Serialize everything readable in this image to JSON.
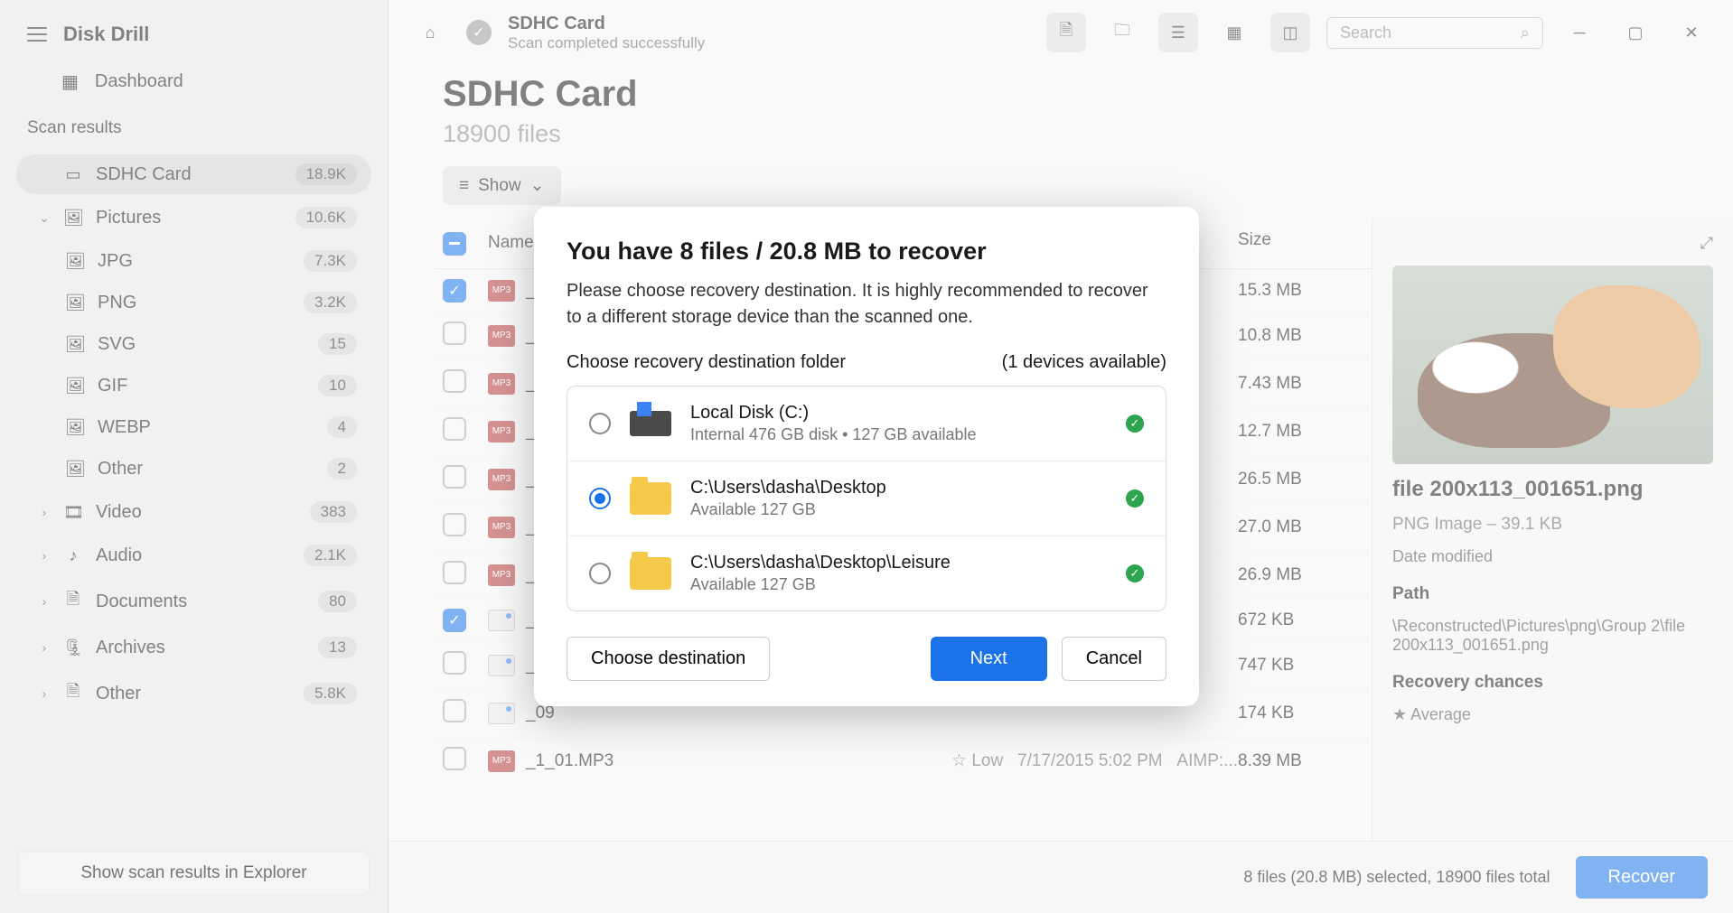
{
  "app": {
    "title": "Disk Drill"
  },
  "sidebar": {
    "dashboard": "Dashboard",
    "scan_results_label": "Scan results",
    "scan_explorer_btn": "Show scan results in Explorer",
    "items": [
      {
        "label": "SDHC Card",
        "count": "18.9K"
      },
      {
        "label": "Pictures",
        "count": "10.6K"
      },
      {
        "label": "JPG",
        "count": "7.3K"
      },
      {
        "label": "PNG",
        "count": "3.2K"
      },
      {
        "label": "SVG",
        "count": "15"
      },
      {
        "label": "GIF",
        "count": "10"
      },
      {
        "label": "WEBP",
        "count": "4"
      },
      {
        "label": "Other",
        "count": "2"
      },
      {
        "label": "Video",
        "count": "383"
      },
      {
        "label": "Audio",
        "count": "2.1K"
      },
      {
        "label": "Documents",
        "count": "80"
      },
      {
        "label": "Archives",
        "count": "13"
      },
      {
        "label": "Other",
        "count": "5.8K"
      }
    ]
  },
  "header": {
    "title": "SDHC Card",
    "status": "Scan completed successfully",
    "search_placeholder": "Search"
  },
  "content": {
    "h1": "SDHC Card",
    "subhead": "18900 files",
    "show_chip": "Show",
    "table_headers": {
      "name": "Name",
      "size": "Size"
    },
    "rows": [
      {
        "name": "_0_",
        "type": "mp3",
        "size": "15.3 MB",
        "checked": true
      },
      {
        "name": "_0_",
        "type": "mp3",
        "size": "10.8 MB",
        "checked": false
      },
      {
        "name": "_0_",
        "type": "mp3",
        "size": "7.43 MB",
        "checked": false
      },
      {
        "name": "_0_",
        "type": "mp3",
        "size": "12.7 MB",
        "checked": false
      },
      {
        "name": "_0.N",
        "type": "mp3",
        "size": "26.5 MB",
        "checked": false
      },
      {
        "name": "_0.N",
        "type": "mp3",
        "size": "27.0 MB",
        "checked": false
      },
      {
        "name": "_0.N",
        "type": "mp3",
        "size": "26.9 MB",
        "checked": false
      },
      {
        "name": "_05",
        "type": "png",
        "size": "672 KB",
        "checked": true
      },
      {
        "name": "_07",
        "type": "png",
        "size": "747 KB",
        "checked": false
      },
      {
        "name": "_09",
        "type": "png",
        "size": "174 KB",
        "checked": false
      },
      {
        "name": "_1_01.MP3",
        "type": "mp3",
        "size": "8.39 MB",
        "checked": false,
        "extra_chance": "Low",
        "extra_date": "7/17/2015 5:02 PM",
        "extra_kind": "AIMP:..."
      }
    ]
  },
  "preview": {
    "filename": "file 200x113_001651.png",
    "meta": "PNG Image – 39.1 KB",
    "date_modified_label": "Date modified",
    "path_label": "Path",
    "path_value": "\\Reconstructed\\Pictures\\png\\Group 2\\file 200x113_001651.png",
    "recovery_label": "Recovery chances",
    "recovery_value": "Average"
  },
  "bottombar": {
    "status": "8 files (20.8 MB) selected, 18900 files total",
    "recover_btn": "Recover"
  },
  "modal": {
    "title": "You have 8 files / 20.8 MB to recover",
    "desc": "Please choose recovery destination. It is highly recommended to recover to a different storage device than the scanned one.",
    "choose_label": "Choose recovery destination folder",
    "devices_label": "(1 devices available)",
    "destinations": [
      {
        "title": "Local Disk (C:)",
        "sub": "Internal 476 GB disk • 127 GB available",
        "icon": "disk",
        "selected": false
      },
      {
        "title": "C:\\Users\\dasha\\Desktop",
        "sub": "Available 127 GB",
        "icon": "folder",
        "selected": true
      },
      {
        "title": "C:\\Users\\dasha\\Desktop\\Leisure",
        "sub": "Available 127 GB",
        "icon": "folder",
        "selected": false
      }
    ],
    "choose_dest_btn": "Choose destination",
    "next_btn": "Next",
    "cancel_btn": "Cancel"
  }
}
